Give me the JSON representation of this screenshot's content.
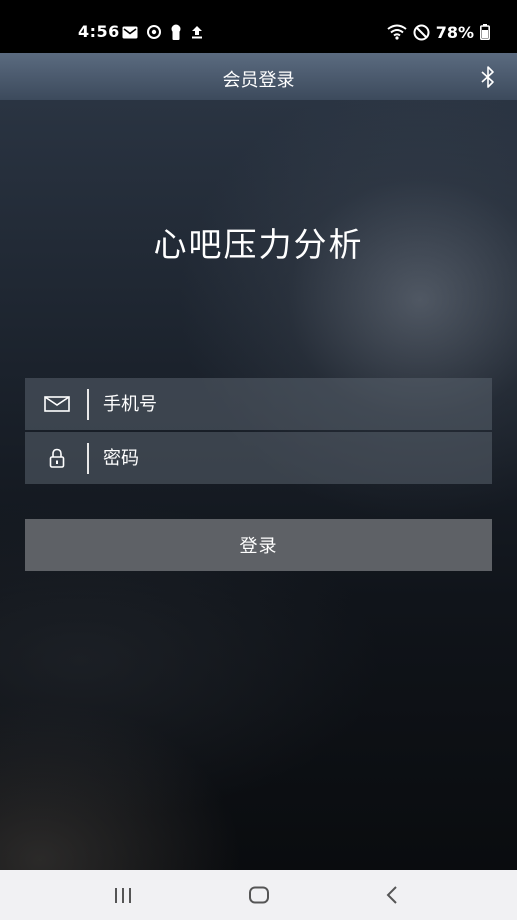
{
  "status_bar": {
    "time": "4:56",
    "battery": "78%",
    "left_icons": [
      "gmail-icon",
      "sync-icon",
      "keyhole-icon",
      "upload-icon"
    ],
    "right_icons": [
      "wifi-icon",
      "do-not-disturb-icon",
      "battery-icon"
    ]
  },
  "header": {
    "title": "会员登录",
    "right_icon": "bluetooth-icon"
  },
  "main": {
    "app_title": "心吧压力分析",
    "phone_field": {
      "placeholder": "手机号",
      "value": "",
      "icon": "mail-icon"
    },
    "password_field": {
      "placeholder": "密码",
      "value": "",
      "icon": "lock-icon"
    },
    "login_button": "登录"
  },
  "nav_bar": {
    "icons": [
      "recents-icon",
      "home-icon",
      "back-icon"
    ]
  },
  "colors": {
    "header_top": "#5b6b80",
    "header_bottom": "#3c4a5c",
    "field_bg": "#5a626e",
    "button_bg": "#5e6166",
    "nav_bg": "#f1f1f3"
  }
}
